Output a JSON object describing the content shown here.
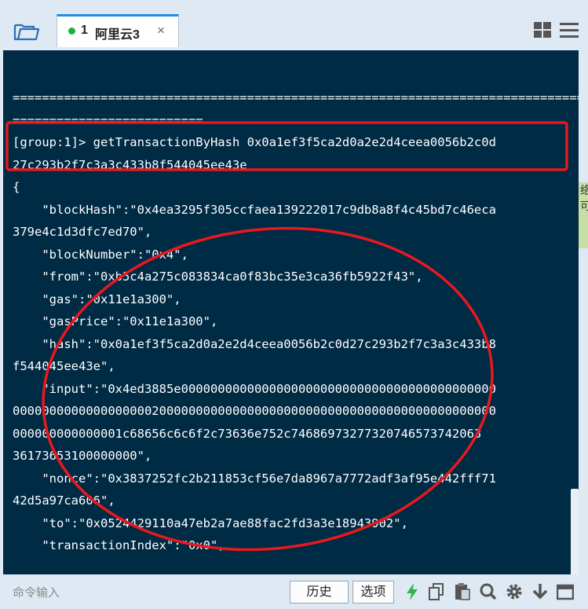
{
  "tab": {
    "number": "1",
    "title": "阿里云3",
    "close_glyph": "×",
    "status_color": "#18b53a"
  },
  "terminal": {
    "lines": [
      "================================================================================",
      "==========================",
      "[group:1]> getTransactionByHash 0x0a1ef3f5ca2d0a2e2d4ceea0056b2c0d",
      "27c293b2f7c3a3c433b8f544045ee43e",
      "{",
      "    \"blockHash\":\"0x4ea3295f305ccfaea139222017c9db8a8f4c45bd7c46eca",
      "379e4c1d3dfc7ed70\",",
      "    \"blockNumber\":\"0x4\",",
      "    \"from\":\"0xb5c4a275c083834ca0f83bc35e3ca36fb5922f43\",",
      "    \"gas\":\"0x11e1a300\",",
      "    \"gasPrice\":\"0x11e1a300\",",
      "    \"hash\":\"0x0a1ef3f5ca2d0a2e2d4ceea0056b2c0d27c293b2f7c3a3c433b8",
      "f544045ee43e\",",
      "    \"input\":\"0x4ed3885e0000000000000000000000000000000000000000000",
      "000000000000000000020000000000000000000000000000000000000000000000",
      "000000000000001c68656c6c6f2c73636e752c74686973277320746573742063",
      "36173653100000000\",",
      "    \"nonce\":\"0x3837252fc2b211853cf56e7da8967a7772adf3af95e442fff71",
      "42d5a97ca606\",",
      "    \"to\":\"0x0524429110a47eb2a7ae88fac2fd3a3e18943902\",",
      "    \"transactionIndex\":\"0x0\","
    ],
    "background": "#002b45",
    "text_color": "#ffffff",
    "annotation_color": "#e8181e"
  },
  "side_strip": {
    "chars": [
      "络",
      "可"
    ]
  },
  "bottom": {
    "input_placeholder": "命令输入",
    "history_label": "历史",
    "options_label": "选项"
  },
  "icons": [
    "folder-icon",
    "grid-view-icon",
    "menu-icon",
    "lightning-icon",
    "copy-icon",
    "paste-icon",
    "search-icon",
    "gear-icon",
    "download-arrow-icon",
    "window-icon"
  ]
}
